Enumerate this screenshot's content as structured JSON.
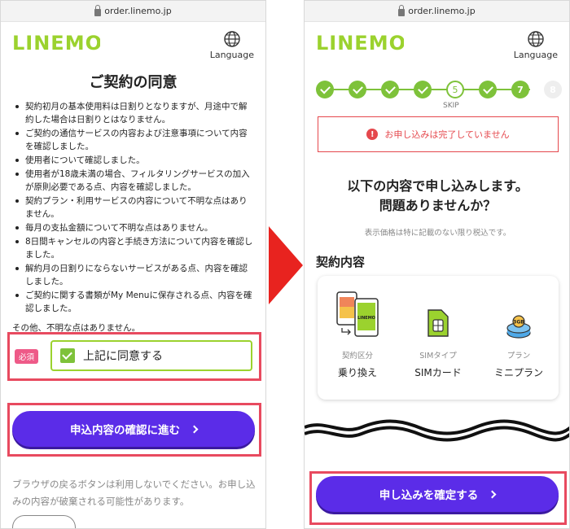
{
  "left": {
    "url": "order.linemo.jp",
    "logo": "LINEMO",
    "language_label": "Language",
    "title": "ご契約の同意",
    "terms": [
      "契約初月の基本使用料は日割りとなりますが、月途中で解約した場合は日割りとはなりません。",
      "ご契約の通信サービスの内容および注意事項について内容を確認しました。",
      "使用者について確認しました。",
      "使用者が18歳未満の場合、フィルタリングサービスの加入が原則必要である点、内容を確認しました。",
      "契約プラン・利用サービスの内容について不明な点はありません。",
      "毎月の支払金額について不明な点はありません。",
      "8日間キャンセルの内容と手続き方法について内容を確認しました。",
      "解約月の日割りにならないサービスがある点、内容を確認しました。",
      "ご契約に関する書類がMy Menuに保存される点、内容を確認しました。"
    ],
    "closing": "その他、不明な点はありません。",
    "required_badge": "必須",
    "agree_label": "上記に同意する",
    "agree_checked": true,
    "next_button": "申込内容の確認に進む",
    "browser_back_note": "ブラウザの戻るボタンは利用しないでください。お申し込みの内容が破棄される可能性があります。"
  },
  "right": {
    "url": "order.linemo.jp",
    "logo": "LINEMO",
    "language_label": "Language",
    "steps": [
      {
        "state": "done",
        "label": ""
      },
      {
        "state": "done",
        "label": ""
      },
      {
        "state": "done",
        "label": ""
      },
      {
        "state": "done",
        "label": ""
      },
      {
        "state": "current",
        "label": "5"
      },
      {
        "state": "done",
        "label": ""
      },
      {
        "state": "active",
        "label": "7"
      },
      {
        "state": "future",
        "label": "8"
      }
    ],
    "skip_label": "SKIP",
    "alert_text": "お申し込みは完了していません",
    "confirm_title_line1": "以下の内容で申し込みします。",
    "confirm_title_line2": "問題ありませんか？",
    "tax_note": "表示価格は特に記載のない限り税込です。",
    "section_title": "契約内容",
    "contract_items": [
      {
        "label": "契約区分",
        "value": "乗り換え",
        "icon": "phone-switch-icon"
      },
      {
        "label": "SIMタイプ",
        "value": "SIMカード",
        "icon": "sim-card-icon"
      },
      {
        "label": "プラン",
        "value": "ミニプラン",
        "icon": "mini-plan-icon"
      }
    ],
    "plan_badge": "3GB",
    "phone_screen_logo": "LINEMO",
    "submit_button": "申し込みを確定する"
  },
  "colors": {
    "brand_green": "#9bd22e",
    "step_green": "#7ec23a",
    "button_purple": "#5b2ce8",
    "highlight_red": "#e84a5f",
    "alert_red": "#e5484d",
    "arrow_red": "#e8231f"
  }
}
